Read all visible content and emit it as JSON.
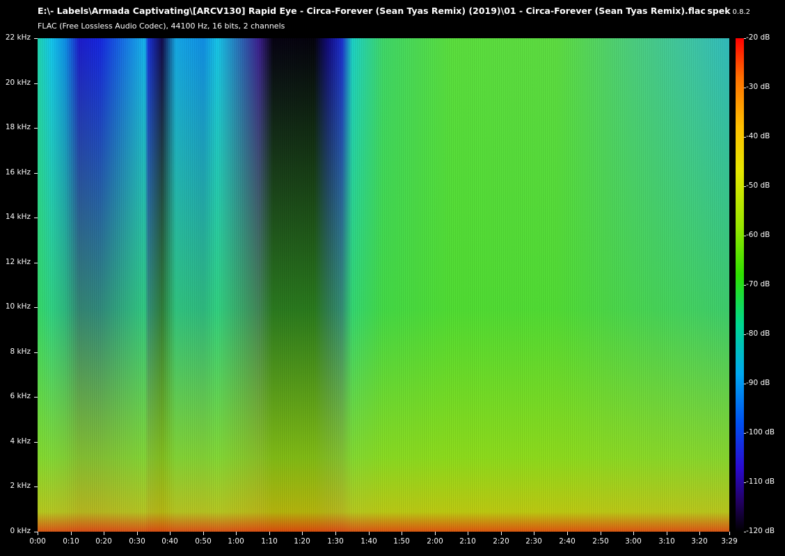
{
  "header": {
    "file_path": "E:\\- Labels\\Armada Captivating\\[ARCV130] Rapid Eye - Circa-Forever (Sean Tyas Remix) (2019)\\01 - Circa-Forever (Sean Tyas Remix).flac",
    "app_name": "spek",
    "app_version": "0.8.2",
    "file_info": "FLAC (Free Lossless Audio Codec), 44100 Hz, 16 bits, 2 channels"
  },
  "frequency_axis": {
    "labels": [
      "22 kHz",
      "20 kHz",
      "18 kHz",
      "16 kHz",
      "14 kHz",
      "12 kHz",
      "10 kHz",
      "8 kHz",
      "6 kHz",
      "4 kHz",
      "2 kHz",
      "0 kHz"
    ]
  },
  "time_axis": {
    "labels": [
      "0:00",
      "0:10",
      "0:20",
      "0:30",
      "0:40",
      "0:50",
      "1:00",
      "1:10",
      "1:20",
      "1:30",
      "1:40",
      "1:50",
      "2:00",
      "2:10",
      "2:20",
      "2:30",
      "2:40",
      "2:50",
      "3:00",
      "3:10",
      "3:20",
      "3:29"
    ]
  },
  "level_scale": {
    "labels": [
      "-20 dB",
      "-30 dB",
      "-40 dB",
      "-50 dB",
      "-60 dB",
      "-70 dB",
      "-80 dB",
      "-90 dB",
      "-100 dB",
      "-110 dB",
      "-120 dB"
    ]
  }
}
